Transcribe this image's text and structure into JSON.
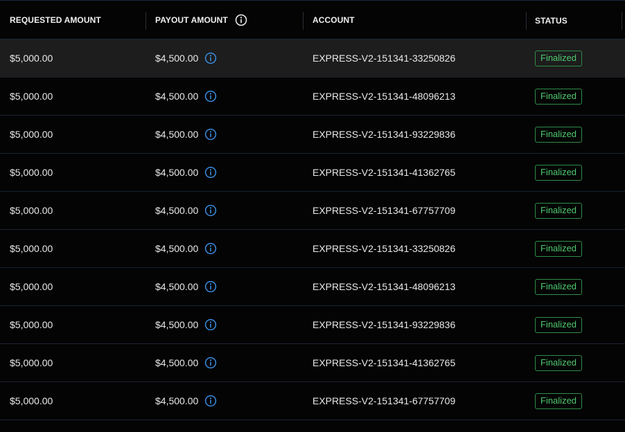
{
  "columns": {
    "requested": "REQUESTED AMOUNT",
    "payout": "PAYOUT AMOUNT",
    "account": "ACCOUNT",
    "status": "STATUS"
  },
  "colors": {
    "info_icon": "#3b8de0",
    "status_finalized": "#4fc96f",
    "highlight_row": "#1d1d1d"
  },
  "icons": {
    "header_info": "info-circle-icon",
    "row_info": "info-circle-icon"
  },
  "rows": [
    {
      "requested": "$5,000.00",
      "payout": "$4,500.00",
      "account": "EXPRESS-V2-151341-33250826",
      "status": "Finalized"
    },
    {
      "requested": "$5,000.00",
      "payout": "$4,500.00",
      "account": "EXPRESS-V2-151341-48096213",
      "status": "Finalized"
    },
    {
      "requested": "$5,000.00",
      "payout": "$4,500.00",
      "account": "EXPRESS-V2-151341-93229836",
      "status": "Finalized"
    },
    {
      "requested": "$5,000.00",
      "payout": "$4,500.00",
      "account": "EXPRESS-V2-151341-41362765",
      "status": "Finalized"
    },
    {
      "requested": "$5,000.00",
      "payout": "$4,500.00",
      "account": "EXPRESS-V2-151341-67757709",
      "status": "Finalized"
    },
    {
      "requested": "$5,000.00",
      "payout": "$4,500.00",
      "account": "EXPRESS-V2-151341-33250826",
      "status": "Finalized"
    },
    {
      "requested": "$5,000.00",
      "payout": "$4,500.00",
      "account": "EXPRESS-V2-151341-48096213",
      "status": "Finalized"
    },
    {
      "requested": "$5,000.00",
      "payout": "$4,500.00",
      "account": "EXPRESS-V2-151341-93229836",
      "status": "Finalized"
    },
    {
      "requested": "$5,000.00",
      "payout": "$4,500.00",
      "account": "EXPRESS-V2-151341-41362765",
      "status": "Finalized"
    },
    {
      "requested": "$5,000.00",
      "payout": "$4,500.00",
      "account": "EXPRESS-V2-151341-67757709",
      "status": "Finalized"
    }
  ]
}
